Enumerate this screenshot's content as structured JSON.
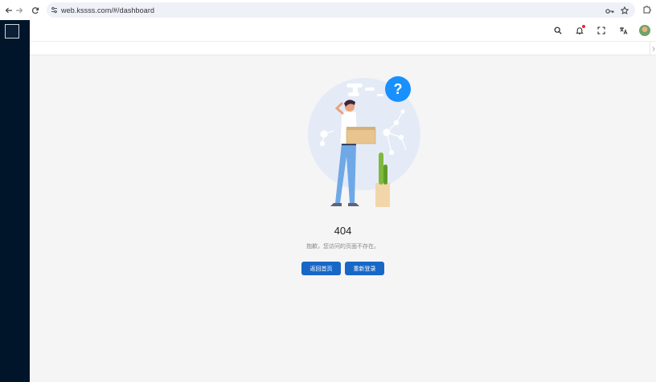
{
  "browser": {
    "url": "web.kssss.com/#/dashboard"
  },
  "main": {
    "error_code": "404",
    "error_message": "抱歉，您访问的页面不存在。",
    "help_symbol": "?",
    "buttons": {
      "home_label": "返回首页",
      "relogin_label": "重新登录"
    }
  },
  "colors": {
    "sidebar": "#001529",
    "primary_button": "#1767c7",
    "background": "#f5f5f5",
    "help_bubble": "#1890ff"
  }
}
